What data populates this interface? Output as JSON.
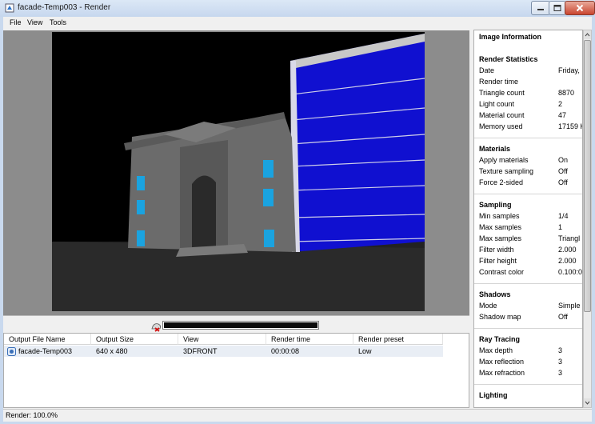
{
  "window": {
    "title": "facade-Temp003 - Render"
  },
  "menu": [
    "File",
    "View",
    "Tools"
  ],
  "progress": {
    "fraction": 1.0
  },
  "table": {
    "headers": [
      "Output File Name",
      "Output Size",
      "View",
      "Render time",
      "Render preset"
    ],
    "rows": [
      [
        "facade-Temp003",
        "640 x 480",
        "3DFRONT",
        "00:00:08",
        "Low"
      ]
    ]
  },
  "info": {
    "title": "Image Information",
    "sections": [
      {
        "name": "Render Statistics",
        "items": [
          [
            "Date",
            "Friday,"
          ],
          [
            "Render time",
            ""
          ],
          [
            "Triangle count",
            "8870"
          ],
          [
            "Light count",
            "2"
          ],
          [
            "Material count",
            "47"
          ],
          [
            "Memory used",
            "17159 K"
          ]
        ]
      },
      {
        "name": "Materials",
        "items": [
          [
            "Apply materials",
            "On"
          ],
          [
            "Texture sampling",
            "Off"
          ],
          [
            "Force 2-sided",
            "Off"
          ]
        ]
      },
      {
        "name": "Sampling",
        "items": [
          [
            "Min samples",
            "1/4"
          ],
          [
            "Max samples",
            "1"
          ],
          [
            "Max samples",
            "Triangl"
          ],
          [
            "Filter width",
            "2.000"
          ],
          [
            "Filter height",
            "2.000"
          ],
          [
            "Contrast color",
            "0.100:0"
          ]
        ]
      },
      {
        "name": "Shadows",
        "items": [
          [
            "Mode",
            "Simple"
          ],
          [
            "Shadow map",
            "Off"
          ]
        ]
      },
      {
        "name": "Ray Tracing",
        "items": [
          [
            "Max depth",
            "3"
          ],
          [
            "Max reflection",
            "3"
          ],
          [
            "Max refraction",
            "3"
          ]
        ]
      },
      {
        "name": "Lighting",
        "items": []
      }
    ]
  },
  "status": {
    "text": "Render: 100.0%"
  },
  "colors": {
    "facade_glass": "#1010d0",
    "window_blue": "#1aa3e0",
    "building_gray": "#6b6b6b"
  }
}
